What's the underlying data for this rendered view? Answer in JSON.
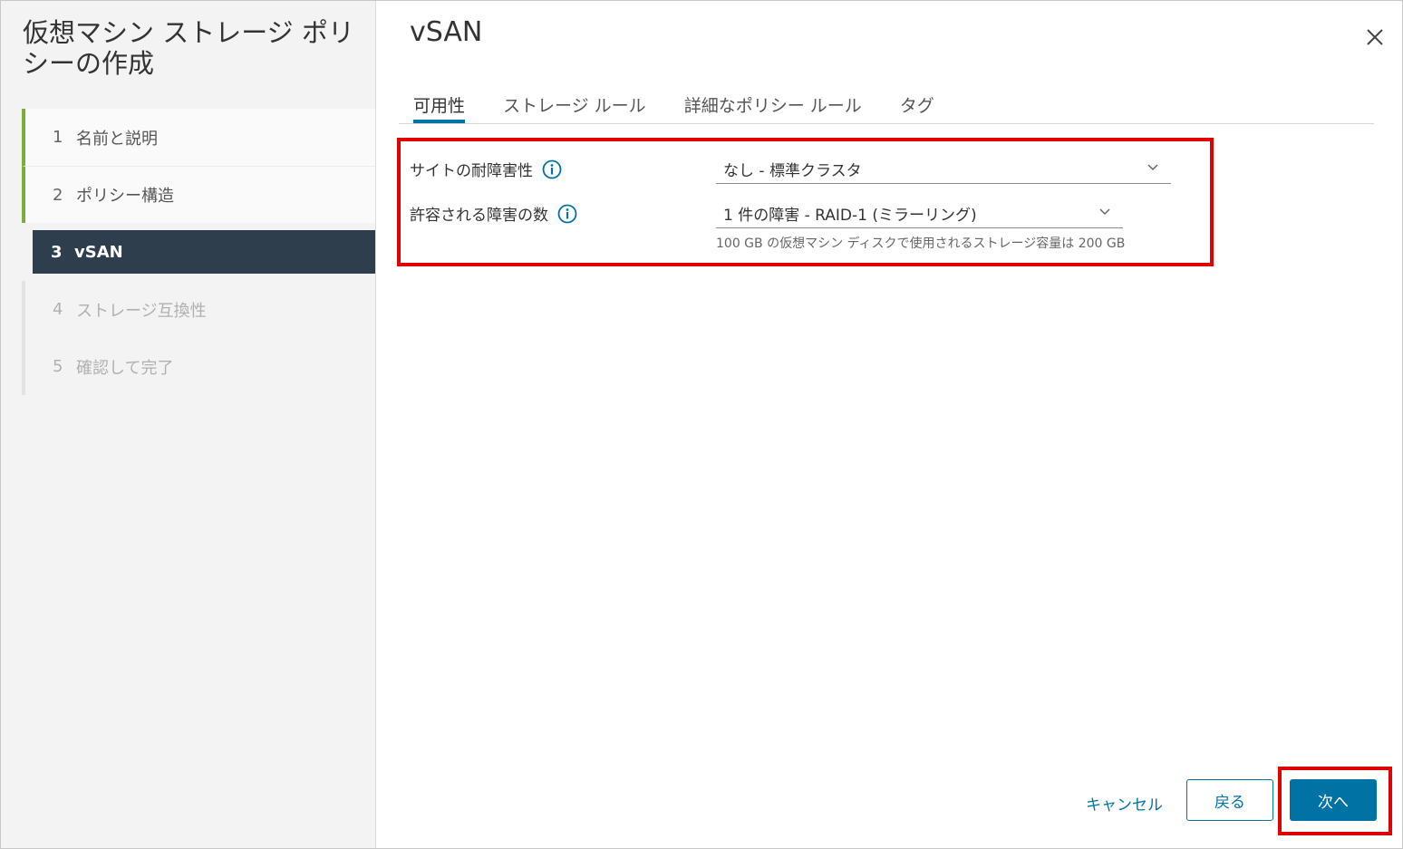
{
  "wizard": {
    "title": "仮想マシン ストレージ ポリシーの作成",
    "steps": [
      {
        "num": "1",
        "label": "名前と説明"
      },
      {
        "num": "2",
        "label": "ポリシー構造"
      },
      {
        "num": "3",
        "label": "vSAN"
      },
      {
        "num": "4",
        "label": "ストレージ互換性"
      },
      {
        "num": "5",
        "label": "確認して完了"
      }
    ]
  },
  "page": {
    "title": "vSAN",
    "tabs": [
      "可用性",
      "ストレージ ルール",
      "詳細なポリシー ルール",
      "タグ"
    ]
  },
  "form": {
    "site_tolerance": {
      "label": "サイトの耐障害性",
      "value": "なし - 標準クラスタ"
    },
    "failures_tolerated": {
      "label": "許容される障害の数",
      "value": "1 件の障害 - RAID-1 (ミラーリング)"
    },
    "hint": "100 GB の仮想マシン ディスクで使用されるストレージ容量は 200 GB"
  },
  "footer": {
    "cancel": "キャンセル",
    "back": "戻る",
    "next": "次へ"
  },
  "colors": {
    "primary": "#0072a3",
    "active_step_bg": "#2f3e4d",
    "step_accent": "#7dad3b",
    "highlight": "#e00000"
  },
  "icons": [
    "info-icon",
    "chevron-down-icon",
    "close-icon"
  ]
}
